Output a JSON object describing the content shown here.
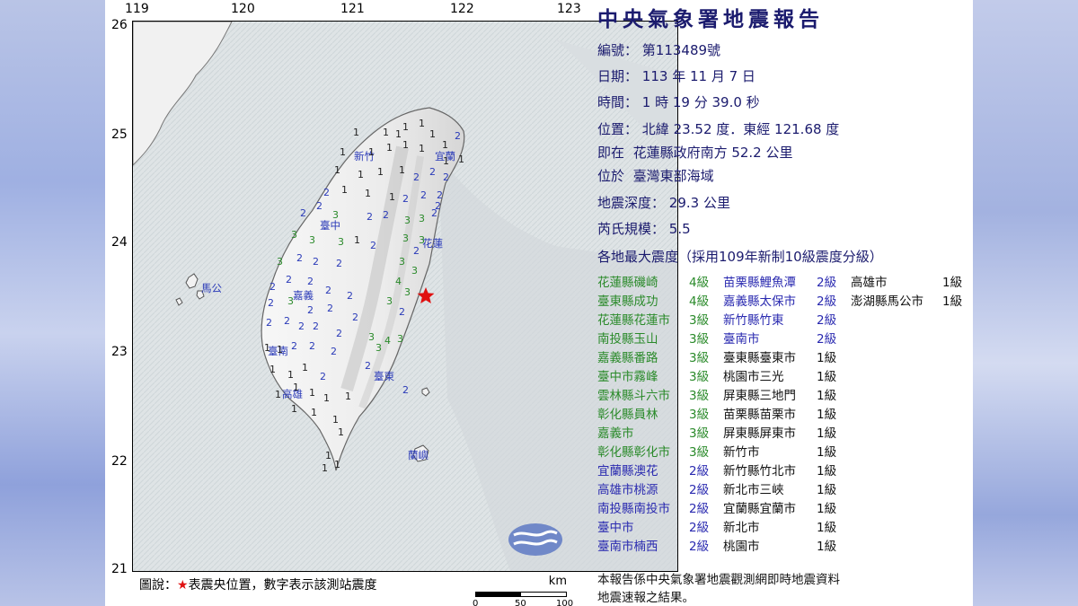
{
  "title": "中央氣象署地震報告",
  "report": {
    "number_label": "編號：",
    "number_value": "第113489號",
    "date_label": "日期：",
    "date_value": "113 年 11 月 7 日",
    "time_label": "時間：",
    "time_value": "1 時 19 分 39.0 秒",
    "position_label": "位置：",
    "position_value": "北緯 23.52 度．東經 121.68 度",
    "near_label": "即在",
    "near_value": "花蓮縣政府南方 52.2 公里",
    "located_label": "位於",
    "located_value": "臺灣東部海域",
    "depth_label": "地震深度：",
    "depth_value": "29.3 公里",
    "magnitude_label": "芮氏規模：",
    "magnitude_value": "5.5",
    "intensity_header": "各地最大震度（採用109年新制10級震度分級）"
  },
  "intensity_columns": [
    [
      {
        "place": "花蓮縣磯崎",
        "level": "4級",
        "tone": "g"
      },
      {
        "place": "臺東縣成功",
        "level": "4級",
        "tone": "g"
      },
      {
        "place": "花蓮縣花蓮市",
        "level": "3級",
        "tone": "g"
      },
      {
        "place": "南投縣玉山",
        "level": "3級",
        "tone": "g"
      },
      {
        "place": "嘉義縣番路",
        "level": "3級",
        "tone": "g"
      },
      {
        "place": "臺中市霧峰",
        "level": "3級",
        "tone": "g"
      },
      {
        "place": "雲林縣斗六市",
        "level": "3級",
        "tone": "g"
      },
      {
        "place": "彰化縣員林",
        "level": "3級",
        "tone": "g"
      },
      {
        "place": "嘉義市",
        "level": "3級",
        "tone": "g"
      },
      {
        "place": "彰化縣彰化市",
        "level": "3級",
        "tone": "g"
      },
      {
        "place": "宜蘭縣澳花",
        "level": "2級",
        "tone": "b"
      },
      {
        "place": "高雄市桃源",
        "level": "2級",
        "tone": "b"
      },
      {
        "place": "南投縣南投市",
        "level": "2級",
        "tone": "b"
      },
      {
        "place": "臺中市",
        "level": "2級",
        "tone": "b"
      },
      {
        "place": "臺南市楠西",
        "level": "2級",
        "tone": "b"
      }
    ],
    [
      {
        "place": "苗栗縣鯉魚潭",
        "level": "2級",
        "tone": "b"
      },
      {
        "place": "嘉義縣太保市",
        "level": "2級",
        "tone": "b"
      },
      {
        "place": "新竹縣竹東",
        "level": "2級",
        "tone": "b"
      },
      {
        "place": "臺南市",
        "level": "2級",
        "tone": "b"
      },
      {
        "place": "臺東縣臺東市",
        "level": "1級",
        "tone": "k"
      },
      {
        "place": "桃園市三光",
        "level": "1級",
        "tone": "k"
      },
      {
        "place": "屏東縣三地門",
        "level": "1級",
        "tone": "k"
      },
      {
        "place": "苗栗縣苗栗市",
        "level": "1級",
        "tone": "k"
      },
      {
        "place": "屏東縣屏東市",
        "level": "1級",
        "tone": "k"
      },
      {
        "place": "新竹市",
        "level": "1級",
        "tone": "k"
      },
      {
        "place": "新竹縣竹北市",
        "level": "1級",
        "tone": "k"
      },
      {
        "place": "新北市三峽",
        "level": "1級",
        "tone": "k"
      },
      {
        "place": "宜蘭縣宜蘭市",
        "level": "1級",
        "tone": "k"
      },
      {
        "place": "新北市",
        "level": "1級",
        "tone": "k"
      },
      {
        "place": "桃園市",
        "level": "1級",
        "tone": "k"
      }
    ],
    [
      {
        "place": "高雄市",
        "level": "1級",
        "tone": "k"
      },
      {
        "place": "澎湖縣馬公市",
        "level": "1級",
        "tone": "k"
      }
    ]
  ],
  "map": {
    "lon_ticks": [
      "119",
      "120",
      "121",
      "122",
      "123"
    ],
    "lat_ticks": [
      "26",
      "25",
      "24",
      "23",
      "22",
      "21"
    ],
    "cities": [
      "新竹",
      "宜蘭",
      "臺中",
      "花蓮",
      "馬公",
      "嘉義",
      "臺南",
      "高雄",
      "臺東",
      "蘭嶼"
    ],
    "epicenter_icon": "red-star-icon",
    "logo_icon": "cwa-logo-icon"
  },
  "legend": {
    "label": "圖說：",
    "star": "★",
    "text": "表震央位置，數字表示該測站震度"
  },
  "scale": {
    "unit": "km",
    "ticks": [
      "0",
      "50",
      "100"
    ]
  },
  "footer": {
    "line1": "本報告係中央氣象署地震觀測網即時地震資料",
    "line2": "地震速報之結果。"
  },
  "colors": {
    "title": "#1b1b6e",
    "level4": "#2a8a2a",
    "level3": "#2a8a2a",
    "level2": "#2a2ab0",
    "level1": "#111111",
    "epicenter": "#e01010"
  }
}
